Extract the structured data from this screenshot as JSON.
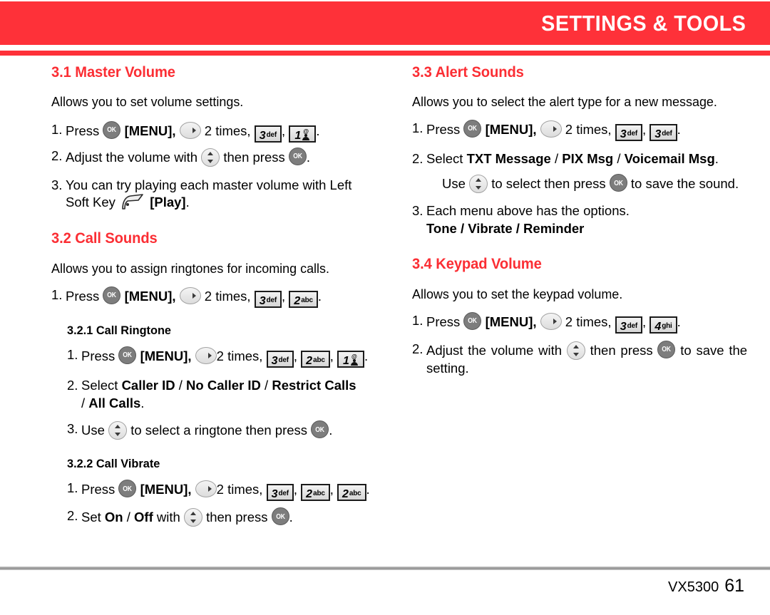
{
  "header": {
    "title": "SETTINGS & TOOLS",
    "bar_color": "#fe3139"
  },
  "colors": {
    "brand_red": "#fe3139",
    "heading_red": "#fb2e34",
    "key_fill": "#e4e4e4",
    "ok_key_fill": "#7d7d7d"
  },
  "icons": {
    "ok_key_label": "OK",
    "nav_right": "nav-right-icon",
    "nav_updown": "nav-up-down-icon",
    "left_soft_key": "left-soft-key-icon"
  },
  "keys": {
    "k1": {
      "digit": "1",
      "sub": "",
      "pictogram": "at-person"
    },
    "k2": {
      "digit": "2",
      "sub": "abc"
    },
    "k3": {
      "digit": "3",
      "sub": "def"
    },
    "k4": {
      "digit": "4",
      "sub": "ghi"
    }
  },
  "left_column": {
    "s31": {
      "heading": "3.1 Master Volume",
      "intro": "Allows you to set volume settings.",
      "step1": {
        "num": "1.",
        "a": "Press",
        "b": "[MENU],",
        "c": "2 times,",
        "comma": ",",
        "period": "."
      },
      "step2": {
        "num": "2.",
        "a": "Adjust the volume with",
        "b": "then press",
        "period": "."
      },
      "step3": {
        "num": "3.",
        "a": "You can try playing each master volume with Left",
        "b": "Soft Key",
        "c": "[Play]",
        "period": "."
      }
    },
    "s32": {
      "heading": "3.2 Call Sounds",
      "intro": "Allows you to assign ringtones for incoming calls.",
      "step1": {
        "num": "1.",
        "a": "Press",
        "b": "[MENU],",
        "c": "2 times,",
        "comma": ",",
        "period": "."
      },
      "s321": {
        "heading": "3.2.1 Call Ringtone",
        "step1": {
          "num": "1.",
          "a": "Press",
          "b": "[MENU],",
          "c": "2 times,",
          "comma1": ",",
          "comma2": ",",
          "period": "."
        },
        "step2": {
          "num": "2.",
          "a": "Select",
          "opt1": "Caller ID",
          "sep1": "/",
          "opt2": "No Caller ID",
          "sep2": "/",
          "opt3": "Restrict Calls",
          "sep3": "/",
          "opt4": "All Calls",
          "period": "."
        },
        "step3": {
          "num": "3.",
          "a": "Use",
          "b": "to select a ringtone then press",
          "period": "."
        }
      },
      "s322": {
        "heading": "3.2.2 Call Vibrate",
        "step1": {
          "num": "1.",
          "a": "Press",
          "b": "[MENU],",
          "c": "2 times,",
          "comma1": ",",
          "comma2": ",",
          "period": "."
        },
        "step2": {
          "num": "2.",
          "a": "Set",
          "on": "On",
          "sep": "/",
          "off": "Off",
          "b": "with",
          "c": "then press",
          "period": "."
        }
      }
    }
  },
  "right_column": {
    "s33": {
      "heading": "3.3 Alert Sounds",
      "intro": "Allows you to select the alert type for a new message.",
      "step1": {
        "num": "1.",
        "a": "Press",
        "b": "[MENU],",
        "c": "2 times,",
        "comma": ",",
        "period": "."
      },
      "step2": {
        "num": "2.",
        "a": "Select",
        "opt1": "TXT Message",
        "sep1": "/",
        "opt2": "PIX Msg",
        "sep2": "/",
        "opt3": "Voicemail Msg",
        "period": ".",
        "cont_a": "Use",
        "cont_b": "to select then press",
        "cont_c": "to save the sound."
      },
      "step3": {
        "num": "3.",
        "a": "Each menu above has the options.",
        "options": "Tone / Vibrate / Reminder"
      }
    },
    "s34": {
      "heading": "3.4 Keypad Volume",
      "intro": "Allows you to set the keypad volume.",
      "step1": {
        "num": "1.",
        "a": "Press",
        "b": "[MENU],",
        "c": "2 times,",
        "comma": ",",
        "period": "."
      },
      "step2": {
        "num": "2.",
        "a": "Adjust the volume with",
        "b": "then press",
        "c": "to save the setting."
      }
    }
  },
  "footer": {
    "model": "VX5300",
    "page": "61"
  }
}
